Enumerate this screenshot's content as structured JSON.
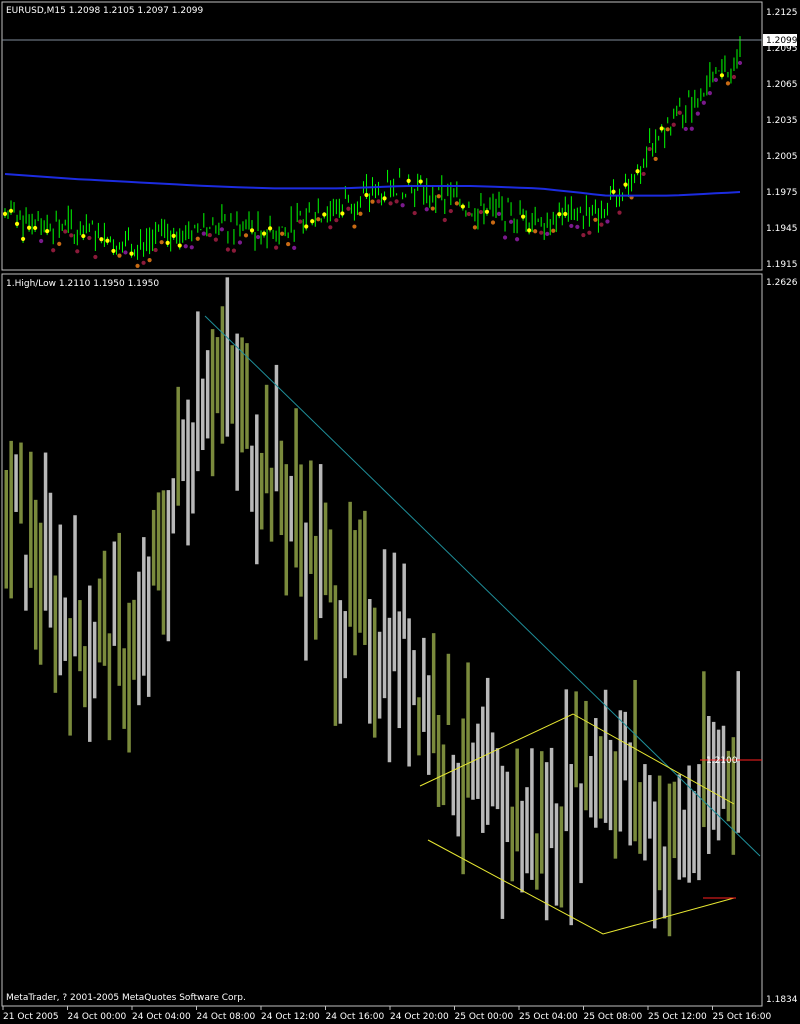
{
  "top_panel": {
    "title": "EURUSD,M15  1.2098 1.2105 1.2097 1.2099",
    "current_price_label": "1.2099",
    "y_ticks": [
      "1.2125",
      "1.2095",
      "1.2065",
      "1.2035",
      "1.2005",
      "1.1975",
      "1.1945",
      "1.1915"
    ]
  },
  "bottom_panel": {
    "title": "1.High/Low 1.2110 1.1950 1.1950",
    "top_value": "1.2626",
    "bottom_value": "1.1834",
    "marker_label": "1.2100"
  },
  "x_ticks": [
    "21 Oct 2005",
    "24 Oct 00:00",
    "24 Oct 04:00",
    "24 Oct 08:00",
    "24 Oct 12:00",
    "24 Oct 16:00",
    "24 Oct 20:00",
    "25 Oct 00:00",
    "25 Oct 04:00",
    "25 Oct 08:00",
    "25 Oct 12:00",
    "25 Oct 16:00"
  ],
  "copyright": "MetaTrader, ? 2001-2005 MetaQuotes Software Corp.",
  "colors": {
    "background": "#000000",
    "candles": "#00ff00",
    "moving_average": "#1c2ce0",
    "dots_up": "#ffff00",
    "dots_mid": "#c86a14",
    "dots_low": "#8b1a3a",
    "dots_purple": "#7a1a8c",
    "bars_light": "#b8b8b8",
    "bars_olive": "#7a8a3c",
    "trendline": "#1f8f9a",
    "channel": "#e8e832",
    "marker": "#ff2020"
  },
  "chart_data": [
    {
      "type": "line",
      "title": "EURUSD,M15",
      "ylim": [
        1.1915,
        1.2125
      ],
      "x": [
        "21 Oct 2005",
        "24 Oct 00:00",
        "24 Oct 04:00",
        "24 Oct 08:00",
        "24 Oct 12:00",
        "24 Oct 16:00",
        "24 Oct 20:00",
        "25 Oct 00:00",
        "25 Oct 04:00",
        "25 Oct 08:00",
        "25 Oct 12:00",
        "25 Oct 16:00"
      ],
      "series": [
        {
          "values": [
            1.1955,
            1.1945,
            1.1932,
            1.1948,
            1.1942,
            1.1965,
            1.1982,
            1.1962,
            1.1955,
            1.196,
            1.2035,
            1.209
          ]
        },
        {
          "values": [
            1.199,
            1.1986,
            1.1983,
            1.198,
            1.1978,
            1.1978,
            1.198,
            1.198,
            1.1978,
            1.1972,
            1.1972,
            1.1975
          ]
        }
      ]
    },
    {
      "type": "bar",
      "title": "1.High/Low",
      "ylim": [
        1.1834,
        1.2626
      ],
      "x": [
        "21 Oct 2005",
        "24 Oct 00:00",
        "24 Oct 04:00",
        "24 Oct 08:00",
        "24 Oct 12:00",
        "24 Oct 16:00",
        "24 Oct 20:00",
        "25 Oct 00:00",
        "25 Oct 04:00",
        "25 Oct 08:00",
        "25 Oct 12:00",
        "25 Oct 16:00"
      ],
      "values": [
        1.238,
        1.224,
        1.221,
        1.254,
        1.242,
        1.226,
        1.222,
        1.206,
        1.201,
        1.211,
        1.199,
        1.211
      ]
    }
  ]
}
